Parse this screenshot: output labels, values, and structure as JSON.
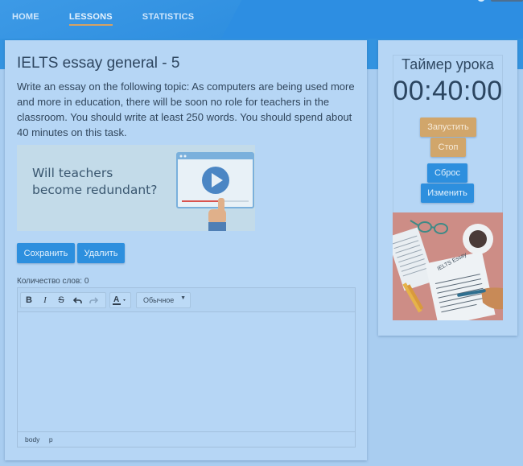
{
  "nav": {
    "items": [
      {
        "label": "HOME",
        "active": false
      },
      {
        "label": "LESSONS",
        "active": true
      },
      {
        "label": "STATISTICS",
        "active": false
      }
    ]
  },
  "lesson": {
    "title": "IELTS essay general - 5",
    "text": "Write an essay on the following topic:   As computers are being used more and more in education, there will be soon no role for teachers in the classroom.  You should write at least 250 words. You should spend about 40 minutes on this task.",
    "image": {
      "caption_line1": "Will teachers",
      "caption_line2": "become redundant?"
    },
    "save_label": "Сохранить",
    "delete_label": "Удалить",
    "word_count": "Количество слов: 0"
  },
  "editor": {
    "toolbar": {
      "bold": "B",
      "italic": "I",
      "strike": "S",
      "format_value": "Обычное"
    },
    "content": "",
    "path": [
      "body",
      "p"
    ]
  },
  "timer": {
    "title": "Таймер урока",
    "time": "00:40:00",
    "start_label": "Запустить",
    "stop_label": "Стоп",
    "reset_label": "Сброс",
    "change_label": "Изменить",
    "illustration_text": "IELTS Essay"
  },
  "colors": {
    "accent_blue": "#2d8fde",
    "accent_orange": "#d1a66b",
    "nav_active_underline": "#d6a262"
  }
}
